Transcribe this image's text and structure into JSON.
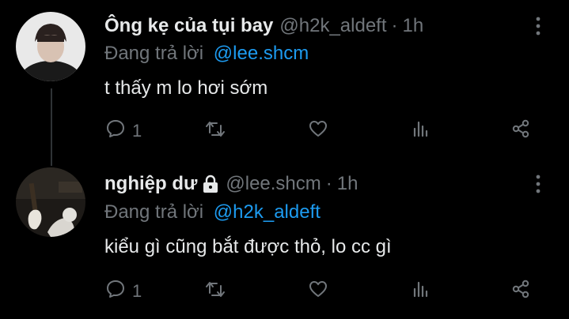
{
  "tweets": [
    {
      "display_name": "Ông kẹ của tụi bay",
      "handle": "@h2k_aldeft",
      "separator": "·",
      "time": "1h",
      "reply_prefix": "Đang trả lời",
      "reply_to": "@lee.shcm",
      "text": "t thấy m lo hơi sớm",
      "reply_count": "1",
      "protected": false
    },
    {
      "display_name": "nghiệp dư",
      "handle": "@lee.shcm",
      "separator": "·",
      "time": "1h",
      "reply_prefix": "Đang trả lời",
      "reply_to": "@h2k_aldeft",
      "text": "kiểu gì cũng bắt được thỏ, lo cc gì",
      "reply_count": "1",
      "protected": true
    }
  ],
  "icons": {
    "reply": "comment-icon",
    "retweet": "retweet-icon",
    "like": "heart-icon",
    "stats": "analytics-icon",
    "share": "share-icon",
    "more": "more-vertical-icon",
    "lock": "lock-icon"
  },
  "colors": {
    "background": "#000000",
    "text": "#e7e9ea",
    "muted": "#71767b",
    "link": "#1d9bf0"
  }
}
